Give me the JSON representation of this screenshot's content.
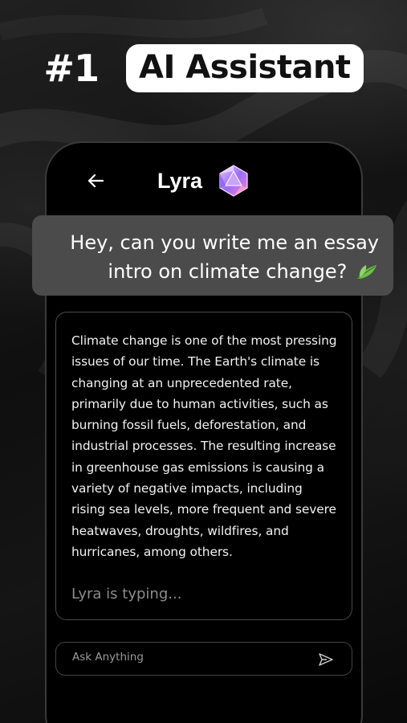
{
  "headline": {
    "rank": "#1",
    "badge": "AI Assistant"
  },
  "chat_header": {
    "title": "Lyra",
    "back_icon": "back-arrow-icon",
    "avatar_icon": "gem-icon"
  },
  "user_message": {
    "line1": "Hey, can you write me an essay",
    "line2": "intro on climate change?",
    "emoji_icon": "leaf-icon"
  },
  "assistant_message": {
    "text": "Climate change is one of the most pressing issues of our time. The Earth's climate is changing at an unprecedented rate, primarily due to human activities, such as burning fossil fuels, deforestation, and industrial processes. The resulting increase in greenhouse gas emissions is causing a variety of negative impacts, including rising sea levels, more frequent and severe heatwaves, droughts, wildfires, and hurricanes, among others.",
    "status": "Lyra is typing..."
  },
  "input": {
    "placeholder": "Ask Anything",
    "value": "",
    "send_icon": "send-icon"
  },
  "colors": {
    "background": "#0d0d0d",
    "bubble": "#4b4b4b",
    "badge_bg": "#ffffff",
    "typing": "#8c8c8c"
  }
}
